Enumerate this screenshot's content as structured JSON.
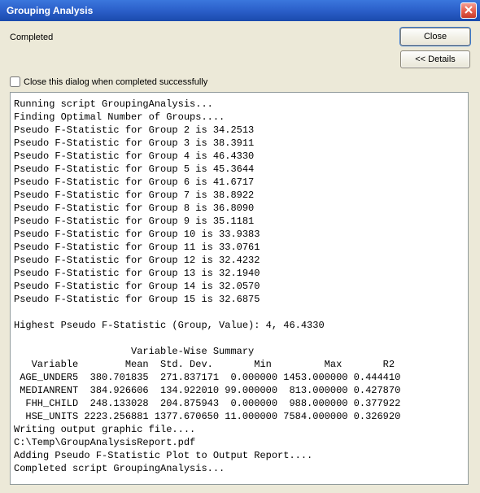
{
  "window": {
    "title": "Grouping Analysis"
  },
  "status": "Completed",
  "buttons": {
    "close": "Close",
    "details": "<< Details"
  },
  "checkbox_label": "Close this dialog when completed successfully",
  "log_lines": [
    "Running script GroupingAnalysis...",
    "Finding Optimal Number of Groups....",
    "Pseudo F-Statistic for Group 2 is 34.2513",
    "Pseudo F-Statistic for Group 3 is 38.3911",
    "Pseudo F-Statistic for Group 4 is 46.4330",
    "Pseudo F-Statistic for Group 5 is 45.3644",
    "Pseudo F-Statistic for Group 6 is 41.6717",
    "Pseudo F-Statistic for Group 7 is 38.8922",
    "Pseudo F-Statistic for Group 8 is 36.8090",
    "Pseudo F-Statistic for Group 9 is 35.1181",
    "Pseudo F-Statistic for Group 10 is 33.9383",
    "Pseudo F-Statistic for Group 11 is 33.0761",
    "Pseudo F-Statistic for Group 12 is 32.4232",
    "Pseudo F-Statistic for Group 13 is 32.1940",
    "Pseudo F-Statistic for Group 14 is 32.0570",
    "Pseudo F-Statistic for Group 15 is 32.6875",
    "",
    "Highest Pseudo F-Statistic (Group, Value): 4, 46.4330",
    "",
    "                    Variable-Wise Summary",
    "   Variable        Mean  Std. Dev.       Min         Max       R2",
    " AGE_UNDER5  380.701835  271.837171  0.000000 1453.000000 0.444410",
    " MEDIANRENT  384.926606  134.922010 99.000000  813.000000 0.427870",
    "  FHH_CHILD  248.133028  204.875943  0.000000  988.000000 0.377922",
    "  HSE_UNITS 2223.256881 1377.670650 11.000000 7584.000000 0.326920",
    "Writing output graphic file....",
    "C:\\Temp\\GroupAnalysisReport.pdf",
    "Adding Pseudo F-Statistic Plot to Output Report....",
    "Completed script GroupingAnalysis..."
  ]
}
